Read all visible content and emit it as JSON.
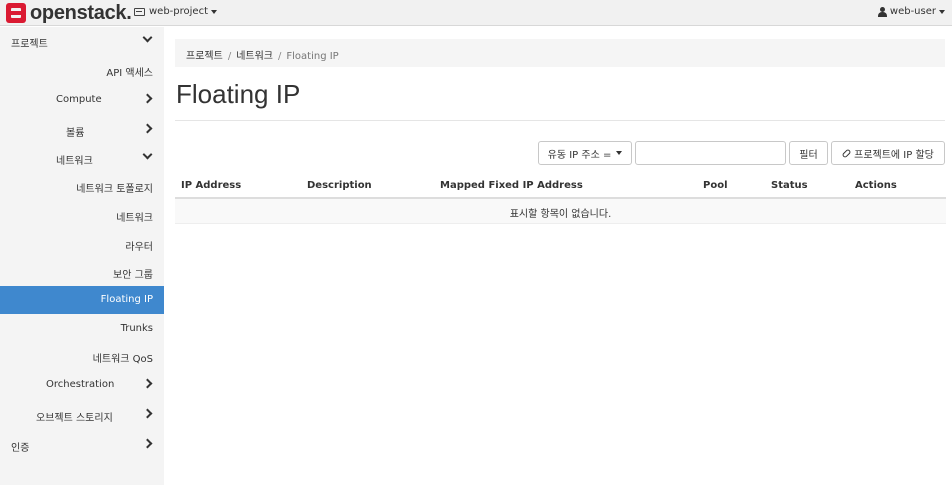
{
  "topbar": {
    "logo_text": "openstack.",
    "project": "web-project",
    "user": "web-user"
  },
  "sidebar": {
    "items": [
      {
        "label": "프로젝트"
      },
      {
        "label": "API 액세스"
      },
      {
        "label": "Compute"
      },
      {
        "label": "볼륨"
      },
      {
        "label": "네트워크"
      },
      {
        "label": "네트워크 토폴로지"
      },
      {
        "label": "네트워크"
      },
      {
        "label": "라우터"
      },
      {
        "label": "보안 그룹"
      },
      {
        "label": "Floating IP"
      },
      {
        "label": "Trunks"
      },
      {
        "label": "네트워크 QoS"
      },
      {
        "label": "Orchestration"
      },
      {
        "label": "오브젝트 스토리지"
      },
      {
        "label": "인증"
      }
    ]
  },
  "breadcrumb": [
    "프로젝트",
    "네트워크",
    "Floating IP"
  ],
  "page_title": "Floating IP",
  "toolbar": {
    "filter_select": "유동 IP 주소 =",
    "filter_input_value": "",
    "filter_button": "필터",
    "allocate_button": "프로젝트에 IP 할당"
  },
  "table": {
    "columns": [
      "IP Address",
      "Description",
      "Mapped Fixed IP Address",
      "Pool",
      "Status",
      "Actions"
    ],
    "empty_message": "표시할 항목이 없습니다."
  },
  "colors": {
    "active_nav": "#3f88ce",
    "brand_red": "#da1a32"
  }
}
